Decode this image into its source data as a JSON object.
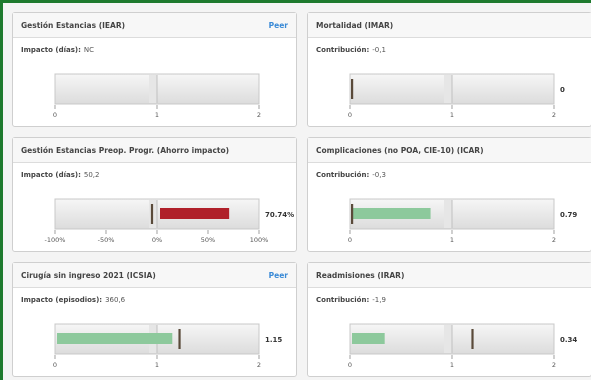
{
  "cards": [
    {
      "title": "Gestión Estancias (IEAR)",
      "peer": "Peer",
      "metric_label": "Impacto (días):",
      "metric_value": "NC",
      "ticks": [
        "0",
        "1",
        "2"
      ],
      "bar_value": null,
      "marker_value": null,
      "value_label": "",
      "bar_color": "#8dc99c",
      "range": [
        0,
        2
      ]
    },
    {
      "title": "Mortalidad (IMAR)",
      "peer": "",
      "metric_label": "Contribución:",
      "metric_value": "-0,1",
      "ticks": [
        "0",
        "1",
        "2"
      ],
      "bar_value": null,
      "marker_value": 0,
      "value_label": "0",
      "bar_color": "#8dc99c",
      "range": [
        0,
        2
      ]
    },
    {
      "title": "Gestión Estancias Preop. Progr. (Ahorro impacto)",
      "peer": "",
      "metric_label": "Impacto (días):",
      "metric_value": "50,2",
      "ticks": [
        "-100%",
        "-50%",
        "0%",
        "50%",
        "100%"
      ],
      "bar_value": 0.7074,
      "marker_value": -0.05,
      "value_label": "70.74%",
      "bar_color": "#b0202a",
      "range": [
        -1,
        1
      ]
    },
    {
      "title": "Complicaciones (no POA, CIE-10) (ICAR)",
      "peer": "",
      "metric_label": "Contribución:",
      "metric_value": "-0,3",
      "ticks": [
        "0",
        "1",
        "2"
      ],
      "bar_value": 0.79,
      "marker_value": 0,
      "value_label": "0.79",
      "bar_color": "#8dc99c",
      "range": [
        0,
        2
      ]
    },
    {
      "title": "Cirugía sin ingreso 2021 (ICSIA)",
      "peer": "Peer",
      "metric_label": "Impacto (episodios):",
      "metric_value": "360,6",
      "ticks": [
        "0",
        "1",
        "2"
      ],
      "bar_value": 1.15,
      "marker_value": 1.22,
      "value_label": "1.15",
      "bar_color": "#8dc99c",
      "range": [
        0,
        2
      ]
    },
    {
      "title": "Readmisiones (IRAR)",
      "peer": "",
      "metric_label": "Contribución:",
      "metric_value": "-1,9",
      "ticks": [
        "0",
        "1",
        "2"
      ],
      "bar_value": 0.34,
      "marker_value": 1.2,
      "value_label": "0.34",
      "bar_color": "#8dc99c",
      "range": [
        0,
        2
      ]
    }
  ],
  "colors": {
    "frame": "#1e7a2e",
    "peer_link": "#3a8ad6",
    "marker": "#5a4a3a"
  }
}
